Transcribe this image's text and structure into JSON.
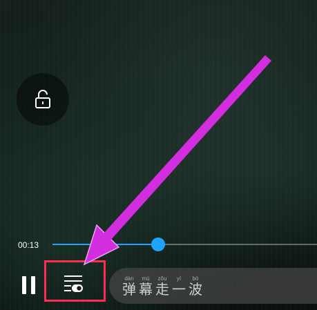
{
  "player": {
    "current_time": "00:13",
    "progress_fraction": 0.4,
    "accent_color": "#1ea3ff",
    "highlight_color": "#ff2d55",
    "arrow_color": "#d22ee0"
  },
  "controls": {
    "lock_icon": "unlock-icon",
    "pause_icon": "pause-icon",
    "danmaku_settings_icon": "danmaku-settings-icon"
  },
  "danmaku_input": {
    "placeholder_chars": [
      {
        "pinyin": "dàn",
        "char": "弹"
      },
      {
        "pinyin": "mù",
        "char": "幕"
      },
      {
        "pinyin": "zǒu",
        "char": "走"
      },
      {
        "pinyin": "yí",
        "char": "一"
      },
      {
        "pinyin": "bō",
        "char": "波"
      }
    ]
  }
}
